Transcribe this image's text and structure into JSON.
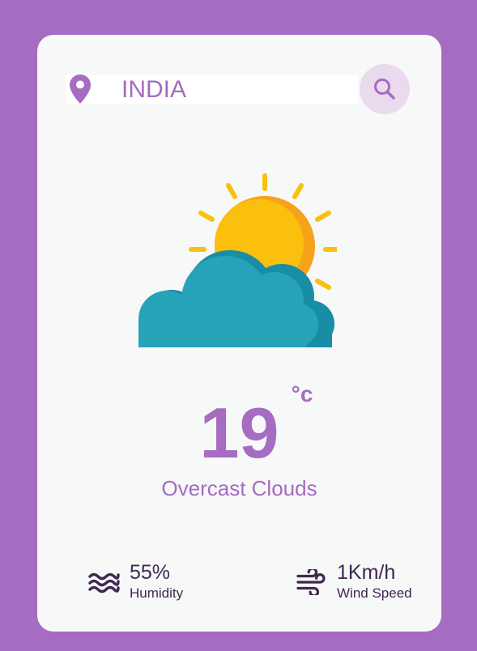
{
  "search": {
    "value": "INDIA",
    "location_icon": "map-pin-icon",
    "button_icon": "search-icon"
  },
  "weather": {
    "icon": "sun-behind-cloud-icon",
    "temperature": "19",
    "unit": "°c",
    "condition": "Overcast Clouds"
  },
  "stats": {
    "humidity": {
      "icon": "waves-icon",
      "value": "55%",
      "label": "Humidity"
    },
    "wind": {
      "icon": "wind-icon",
      "value": "1Km/h",
      "label": "Wind Speed"
    }
  },
  "colors": {
    "background": "#a56cc1",
    "card": "#f7f8f8",
    "accent": "#a56cc1",
    "dark_text": "#3f2850",
    "search_button": "#eadaee",
    "sun": "#fbbf0e",
    "sun_shade": "#f7a21b",
    "cloud": "#27a3b9",
    "cloud_shade": "#178ea5"
  }
}
